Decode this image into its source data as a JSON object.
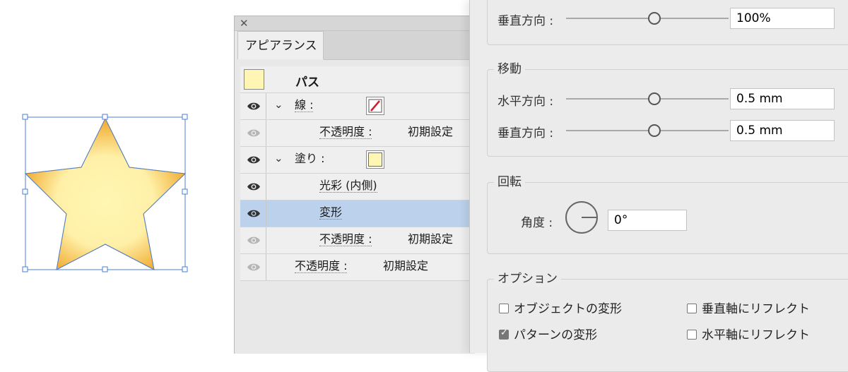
{
  "appearance": {
    "tab_label": "アピアランス",
    "path_label": "パス",
    "rows": [
      {
        "kind": "stroke",
        "label": "線 :",
        "has_chevron": true,
        "eye": "visible"
      },
      {
        "kind": "opacity-sub",
        "label": "不透明度 :",
        "value": "初期設定",
        "eye": "dim"
      },
      {
        "kind": "fill",
        "label": "塗り :",
        "has_chevron": true,
        "eye": "visible"
      },
      {
        "kind": "effect",
        "label": "光彩 (内側)",
        "eye": "visible"
      },
      {
        "kind": "effect-selected",
        "label": "変形",
        "eye": "visible"
      },
      {
        "kind": "opacity-sub",
        "label": "不透明度 :",
        "value": "初期設定",
        "eye": "dim"
      },
      {
        "kind": "opacity",
        "label": "不透明度 :",
        "value": "初期設定",
        "eye": "dim"
      }
    ]
  },
  "transform": {
    "scale_vertical": {
      "label": "垂直方向 :",
      "value": "100%"
    },
    "move": {
      "title": "移動",
      "horizontal": {
        "label": "水平方向 :",
        "value": "0.5 mm"
      },
      "vertical": {
        "label": "垂直方向 :",
        "value": "0.5 mm"
      }
    },
    "rotate": {
      "title": "回転",
      "angle_label": "角度 :",
      "angle_value": "0°"
    },
    "options": {
      "title": "オプション",
      "transform_objects": {
        "label": "オブジェクトの変形",
        "checked": false
      },
      "reflect_vertical": {
        "label": "垂直軸にリフレクト",
        "checked": false
      },
      "transform_patterns": {
        "label": "パターンの変形",
        "checked": true
      },
      "reflect_horizontal": {
        "label": "水平軸にリフレクト",
        "checked": false
      }
    }
  },
  "colors": {
    "fill": "#fff6b3",
    "star_edge": "#f0a82a",
    "selection": "#4a7fd6",
    "selected_row": "#bcd2ec",
    "stroke_slash": "#d0202e"
  }
}
